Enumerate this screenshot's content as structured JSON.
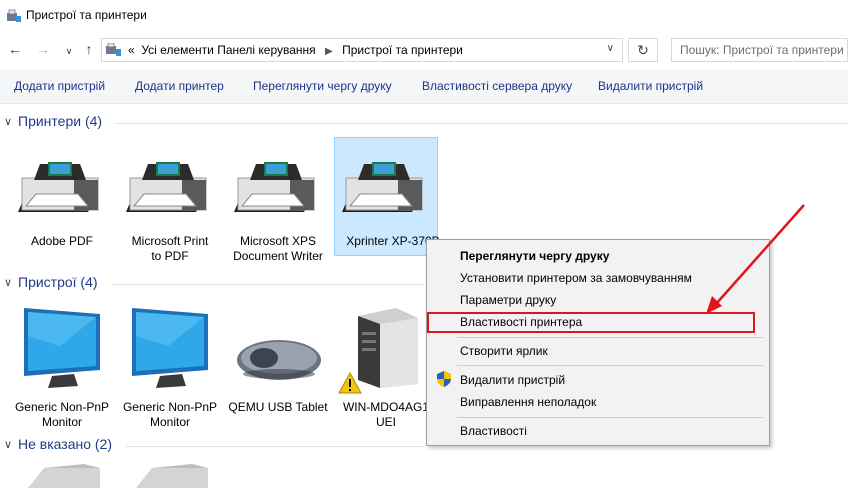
{
  "window": {
    "title": "Пристрої та принтери"
  },
  "address": {
    "prefix": "«",
    "crumbs": [
      "Усі елементи Панелі керування",
      "Пристрої та принтери"
    ],
    "search_placeholder": "Пошук: Пристрої та принтери"
  },
  "commands": [
    "Додати пристрій",
    "Додати принтер",
    "Переглянути чергу друку",
    "Властивості сервера друку",
    "Видалити пристрій"
  ],
  "groups": {
    "printers": {
      "label": "Принтери (4)"
    },
    "devices": {
      "label": "Пристрої (4)"
    },
    "unspecified": {
      "label": "Не вказано (2)"
    }
  },
  "printers": [
    {
      "line1": "Adobe PDF",
      "line2": ""
    },
    {
      "line1": "Microsoft Print",
      "line2": "to PDF"
    },
    {
      "line1": "Microsoft XPS",
      "line2": "Document Writer"
    },
    {
      "line1": "Xprinter XP-370B",
      "line2": ""
    }
  ],
  "devices": [
    {
      "line1": "Generic Non-PnP",
      "line2": "Monitor"
    },
    {
      "line1": "Generic Non-PnP",
      "line2": "Monitor"
    },
    {
      "line1": "QEMU USB Tablet",
      "line2": ""
    },
    {
      "line1": "WIN-MDO4AG1",
      "line2": "UEI"
    }
  ],
  "context_menu": {
    "items": [
      "Переглянути чергу друку",
      "Установити принтером за замовчуванням",
      "Параметри друку",
      "Властивості принтера",
      "Створити ярлик",
      "Видалити пристрій",
      "Виправлення неполадок",
      "Властивості"
    ],
    "highlighted_index": 3
  },
  "colors": {
    "accent": "#1e3b8a",
    "highlight": "#e0141c",
    "selection": "#cce8ff"
  },
  "icons": {
    "back": "arrow-left-icon",
    "forward": "arrow-right-icon",
    "up": "arrow-up-icon",
    "refresh": "refresh-icon",
    "printer": "printer-icon",
    "monitor": "monitor-icon",
    "mouse": "mouse-icon",
    "computer": "computer-tower-icon",
    "warning": "warning-icon",
    "shield": "uac-shield-icon"
  }
}
